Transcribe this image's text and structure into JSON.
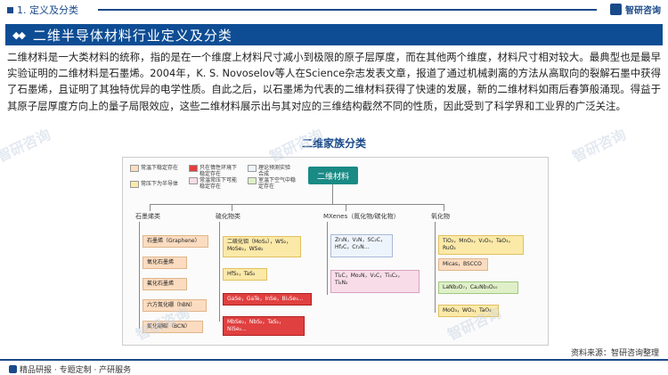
{
  "header": {
    "section": "1. 定义及分类",
    "logo": "智研咨询"
  },
  "banner": {
    "title": "二维半导体材料行业定义及分类"
  },
  "paragraph": "二维材料是一大类材料的统称，指的是在一个维度上材料尺寸减小到极限的原子层厚度，而在其他两个维度，材料尺寸相对较大。最典型也是最早实验证明的二维材料是石墨烯。2004年，K. S. Novoselov等人在Science杂志发表文章，报道了通过机械剥离的方法从高取向的裂解石墨中获得了石墨烯，且证明了其独特优异的电学性质。自此之后，以石墨烯为代表的二维材料获得了快速的发展，新的二维材料如雨后春笋般涌现。得益于其原子层厚度方向上的量子局限效应，这些二维材料展示出与其对应的三维结构截然不同的性质，因此受到了科学界和工业界的广泛关注。",
  "diagram": {
    "title": "二维家族分类",
    "root": "二维材料",
    "legend": [
      {
        "label": "常温下稳定存在",
        "color": "#fbdcc0"
      },
      {
        "label": "只在惰性环境下稳定存在",
        "color": "#e04040"
      },
      {
        "label": "理论预测实验合成",
        "color": "#eef4fb"
      },
      {
        "label": "常压下为半导体",
        "color": "#fbe9a8"
      },
      {
        "label": "常温常压下可能稳定存在",
        "color": "#f8dde8"
      },
      {
        "label": "室温下空气中稳定存在",
        "color": "#dff0c8"
      }
    ],
    "categories": [
      {
        "name": "石墨烯类",
        "items": [
          "石墨烯（Graphene）",
          "氧化石墨烯",
          "氟化石墨烯",
          "六方氮化硼（hBN）",
          "氮化硼碳（BCN）"
        ]
      },
      {
        "name": "硫化物类",
        "items": [
          "二硫化钼（MoS₂），WS₂，MoSe₂，WSe₂",
          "HfS₂，TaS₂",
          "GaSe，GaTe，InSe，Bi₂Se₃...",
          "MbSe₂，NbS₂，TaS₂，NiSe₂..."
        ]
      },
      {
        "name": "MXenes（氮化物/碳化物）",
        "items": [
          "Zr₃N，V₂N，SC₂C，Hf₂C，Cr₂N...",
          "Ti₂C，Mo₂N，V₂C，Ti₃C₂，Ti₂N₂"
        ]
      },
      {
        "name": "氧化物",
        "items": [
          "TiO₂，MnO₂，V₂O₅，TaO₃，RuO₂",
          "Micas，BSCCO",
          "LaNb₂O₇，Ca₂Nb₃O₁₀",
          "MoO₃，WO₃，TaO₃"
        ]
      }
    ]
  },
  "footer": {
    "left": "精品研报 · 专题定制 · 产研服务",
    "source": "资料来源：智研咨询整理"
  },
  "watermark": "智研咨询"
}
